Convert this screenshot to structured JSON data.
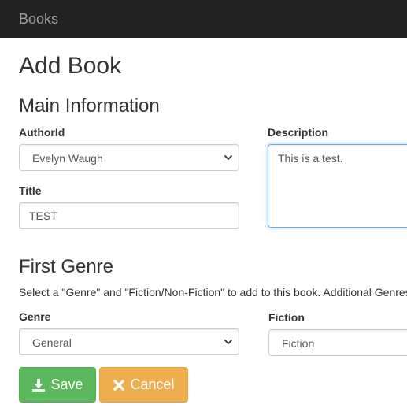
{
  "navbar": {
    "brand": "Books"
  },
  "page": {
    "title": "Add Book"
  },
  "main_info": {
    "heading": "Main Information",
    "author_label": "AuthorId",
    "author_value": "Evelyn Waugh",
    "title_label": "Title",
    "title_value": "TEST",
    "description_label": "Description",
    "description_value": "This is a test."
  },
  "first_genre": {
    "heading": "First Genre",
    "help_text": "Select a \"Genre\" and \"Fiction/Non-Fiction\" to add to this book. Additional Genres",
    "genre_label": "Genre",
    "genre_value": "General",
    "fiction_label": "Fiction",
    "fiction_value": "Fiction"
  },
  "buttons": {
    "save_label": "Save",
    "cancel_label": "Cancel"
  },
  "icons": {
    "save": "download-icon",
    "cancel": "close-icon",
    "dropdown": "chevron-down-icon"
  },
  "colors": {
    "navbar_bg": "#222222",
    "save_bg": "#5cb85c",
    "cancel_bg": "#f0ad4e",
    "focus_border": "#66afe9"
  }
}
